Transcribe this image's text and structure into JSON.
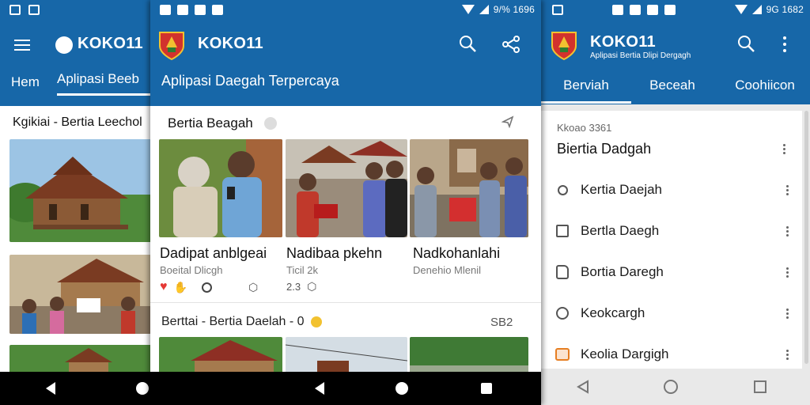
{
  "screen1": {
    "status_time": "",
    "app_title": "KOKO11",
    "tabs": [
      "Hem",
      "Aplipasi Beeb"
    ],
    "section_header": "Kgikiai - Bertia Leechol"
  },
  "screen2": {
    "status_time": "9/% 1696",
    "app_title": "KOKO11",
    "app_subtitle": "Aplipasi Daegah Terpercaya",
    "section_header": "Bertia Beagah",
    "cards": [
      {
        "title": "Dadipat anblgeai",
        "subtitle": "Boeital Dlicgh",
        "meta": ""
      },
      {
        "title": "Nadibaa pkehn",
        "subtitle": "Ticil 2k",
        "meta": "2.3"
      },
      {
        "title": "Nadkohanlahi",
        "subtitle": "Denehio Mlenil",
        "meta": ""
      }
    ],
    "second_section_header": "Berttai - Bertia Daelah - 0",
    "second_section_count": "SB2"
  },
  "screen3": {
    "status_time": "9G 1682",
    "app_title": "KOKO11",
    "app_subtitle": "Aplipasi Bertia Dlipi Dergagh",
    "tabs": [
      "Berviah",
      "Beceah",
      "Coohiicon"
    ],
    "list_header_small": "Kkoao 3361",
    "list_header": "Biertia Dadgah",
    "items": [
      {
        "label": "Kertia Daejah",
        "icon": "clock-icon"
      },
      {
        "label": "Bertla Daegh",
        "icon": "calendar-icon"
      },
      {
        "label": "Bortia Daregh",
        "icon": "folder-icon"
      },
      {
        "label": "Keokcargh",
        "icon": "timer-icon"
      },
      {
        "label": "Keolia Dargigh",
        "icon": "bag-icon"
      }
    ]
  },
  "colors": {
    "primary": "#1767a8",
    "navbar": "#000000",
    "heart": "#e53935",
    "accent_icon": "#e67e22"
  }
}
